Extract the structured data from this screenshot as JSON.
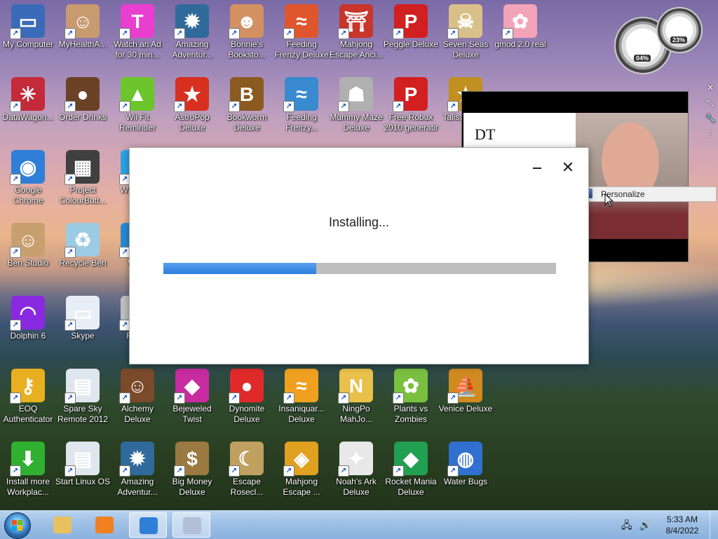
{
  "desktop": {
    "icons": [
      {
        "label": "My Computer",
        "color": "#3a6bb8",
        "glyph": "▭"
      },
      {
        "label": "MyHealthA...",
        "color": "#c89a70",
        "glyph": "☺"
      },
      {
        "label": "Watch an Ad for 30 min...",
        "color": "#e83fd1",
        "glyph": "T"
      },
      {
        "label": "Amazing Adventur...",
        "color": "#2f6a9a",
        "glyph": "✹"
      },
      {
        "label": "Bonnie's Booksto...",
        "color": "#d39060",
        "glyph": "☻"
      },
      {
        "label": "Feeding Frenzy Deluxe",
        "color": "#e0562c",
        "glyph": "≈"
      },
      {
        "label": "Mahjong Escape Anci...",
        "color": "#c8352a",
        "glyph": "⛩"
      },
      {
        "label": "Peggle Deluxe",
        "color": "#d21f1f",
        "glyph": "P"
      },
      {
        "label": "Seven Seas Deluxe",
        "color": "#d8c08a",
        "glyph": "☠"
      },
      {
        "label": "gmod 2.0 real",
        "color": "#f2a3b8",
        "glyph": "✿"
      },
      {
        "label": "DataWagon...",
        "color": "#c42a3a",
        "glyph": "✳"
      },
      {
        "label": "Order Drinks",
        "color": "#6b4226",
        "glyph": "●"
      },
      {
        "label": "Wii Fit Reminder",
        "color": "#6cc52c",
        "glyph": "▲"
      },
      {
        "label": "AstroPop Deluxe",
        "color": "#d83020",
        "glyph": "★"
      },
      {
        "label": "Bookworm Deluxe",
        "color": "#8a5a20",
        "glyph": "B"
      },
      {
        "label": "Feeding Frenzy...",
        "color": "#3a8ad0",
        "glyph": "≈"
      },
      {
        "label": "Mummy Maze Deluxe",
        "color": "#b0b0b0",
        "glyph": "☗"
      },
      {
        "label": "Free Robux 2010 generatir",
        "color": "#d21f1f",
        "glyph": "P"
      },
      {
        "label": "Talis... Del...",
        "color": "#c09020",
        "glyph": "★"
      },
      {
        "label": "Google Chrome",
        "color": "#2f7fd8",
        "glyph": "◉"
      },
      {
        "label": "Project ColourButt...",
        "color": "#404040",
        "glyph": "▦"
      },
      {
        "label": "W... Up...",
        "color": "#2aa4e6",
        "glyph": "▮"
      },
      {
        "label": "Ben Studio",
        "color": "#c8a070",
        "glyph": "☺"
      },
      {
        "label": "Recycle Ben",
        "color": "#9ccbe4",
        "glyph": "♻"
      },
      {
        "label": "Wa...",
        "color": "#2a8ad6",
        "glyph": "▮"
      },
      {
        "label": "Dolphin 6",
        "color": "#8a2ae0",
        "glyph": "◠"
      },
      {
        "label": "Skype",
        "color": "#e8eef8",
        "glyph": "▭"
      },
      {
        "label": "Rec...",
        "color": "#c0c0c0",
        "glyph": "▯"
      },
      {
        "label": "EOQ Authenticator",
        "color": "#e8b020",
        "glyph": "⚷"
      },
      {
        "label": "Spare Sky Remote 2012",
        "color": "#e0e6ee",
        "glyph": "▤"
      },
      {
        "label": "Alchemy Deluxe",
        "color": "#7a4a2a",
        "glyph": "☺"
      },
      {
        "label": "Bejeweled Twist",
        "color": "#c82aa0",
        "glyph": "◆"
      },
      {
        "label": "Dynomite Deluxe",
        "color": "#e02a2a",
        "glyph": "●"
      },
      {
        "label": "Insaniquar... Deluxe",
        "color": "#f0a020",
        "glyph": "≈"
      },
      {
        "label": "NingPo MahJo...",
        "color": "#e8c04a",
        "glyph": "N"
      },
      {
        "label": "Plants vs Zombies",
        "color": "#7ac040",
        "glyph": "✿"
      },
      {
        "label": "Venice Deluxe",
        "color": "#d08a20",
        "glyph": "⛵"
      },
      {
        "label": "Install more Workplac...",
        "color": "#30b030",
        "glyph": "⬇"
      },
      {
        "label": "Start Linux OS",
        "color": "#e0e6ee",
        "glyph": "▤"
      },
      {
        "label": "Amazing Adventur...",
        "color": "#2f6a9a",
        "glyph": "✹"
      },
      {
        "label": "Big Money Deluxe",
        "color": "#9a7a40",
        "glyph": "$"
      },
      {
        "label": "Escape Rosecl...",
        "color": "#c0a060",
        "glyph": "☾"
      },
      {
        "label": "Mahjong Escape ...",
        "color": "#e0a020",
        "glyph": "◈"
      },
      {
        "label": "Noah's Ark Deluxe",
        "color": "#e8e8e8",
        "glyph": "✦"
      },
      {
        "label": "Rocket Mania Deluxe",
        "color": "#20a050",
        "glyph": "◆"
      },
      {
        "label": "Water Bugs",
        "color": "#3070d0",
        "glyph": "◍"
      }
    ]
  },
  "gadget": {
    "cpu": "04%",
    "memory": "23%"
  },
  "photo": {
    "paper_text": "DT"
  },
  "context_menu": {
    "item": "Personalize"
  },
  "dialog": {
    "status": "Installing...",
    "progress": 0.39,
    "progress_color": "#3a8be6",
    "minimize_glyph": "—",
    "close_glyph": "✕"
  },
  "taskbar": {
    "time": "5:33 AM",
    "date": "8/4/2022",
    "buttons": [
      {
        "name": "explorer",
        "color": "#e8c060"
      },
      {
        "name": "media-player",
        "color": "#f08020"
      },
      {
        "name": "chrome",
        "color": "#2f7fd8"
      },
      {
        "name": "cd-installer",
        "color": "#b0c0d8"
      }
    ]
  }
}
